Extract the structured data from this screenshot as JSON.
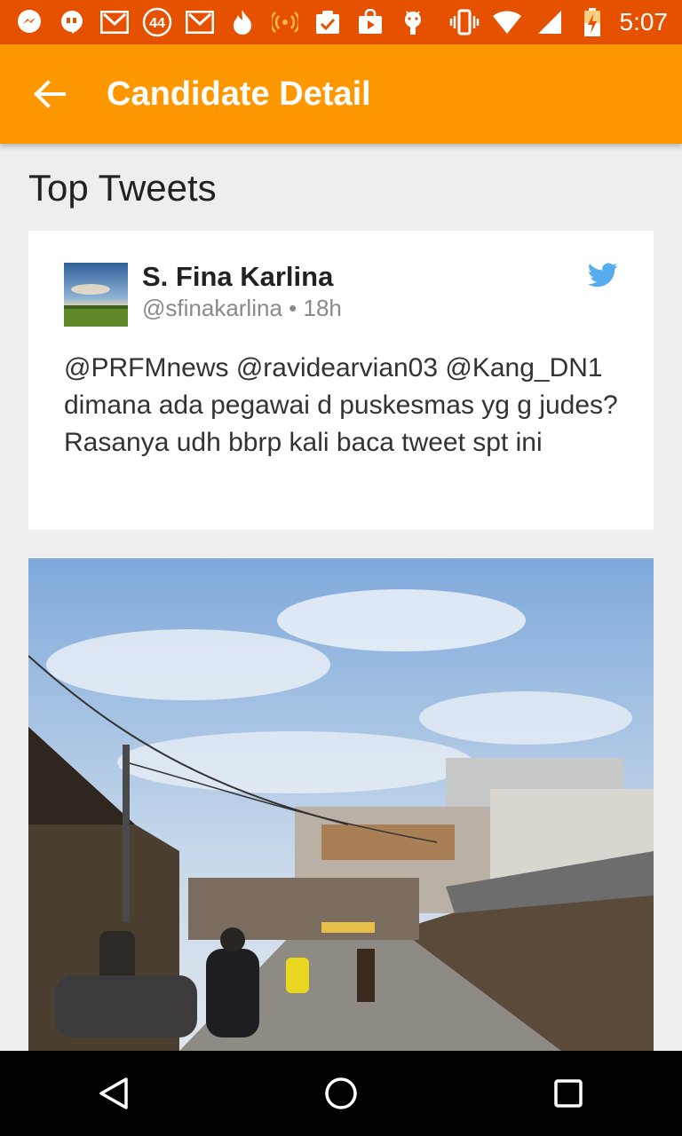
{
  "status_bar": {
    "time": "5:07",
    "notification_badge": "44",
    "icons": [
      "messenger-icon",
      "hangouts-icon",
      "gmail-icon",
      "badge-44-icon",
      "gmail-icon",
      "tinder-flame-icon",
      "wifi-signal-icon",
      "task-check-icon",
      "play-store-icon",
      "android-icon",
      "vibrate-icon",
      "wifi-icon",
      "cell-signal-icon",
      "battery-charging-icon"
    ]
  },
  "app_bar": {
    "title": "Candidate Detail",
    "back_icon": "arrow-back-icon"
  },
  "section": {
    "title": "Top Tweets"
  },
  "tweet": {
    "name": "S. Fina Karlina",
    "handle": "@sfinakarlina",
    "separator": "•",
    "time": "18h",
    "text": "@PRFMnews @ravidearvian03 @Kang_DN1 dimana ada pegawai d puskesmas yg g judes? Rasanya udh bbrp kali baca tweet spt ini"
  },
  "colors": {
    "status_bar": "#e65100",
    "app_bar": "#ff9800",
    "twitter": "#55acee",
    "background": "#eeeeee"
  },
  "nav_bar": {
    "buttons": [
      "back-triangle-icon",
      "home-circle-icon",
      "recents-square-icon"
    ]
  }
}
